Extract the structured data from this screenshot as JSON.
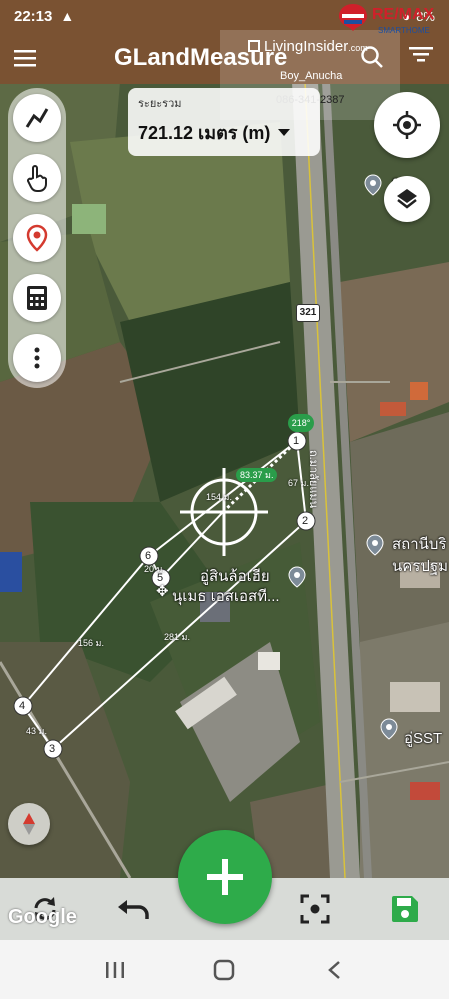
{
  "status": {
    "time": "22:13",
    "warning_icon": "warning-icon",
    "battery_text": "8%"
  },
  "app": {
    "title": "GLandMeasure"
  },
  "watermark": {
    "brand": "LivingInsider",
    "brand_suffix": ".com",
    "user": "Boy_Anucha",
    "phone": "086-341-2387",
    "remax_text": "RE/MAX",
    "remax_sub": "SMARTHOME"
  },
  "distance": {
    "label": "ระยะรวม",
    "value": "721.12 เมตร (m)"
  },
  "toolbar": {
    "tools": [
      "line-measure-icon",
      "touch-icon",
      "location-pin-icon",
      "calculator-icon",
      "more-vertical-icon"
    ]
  },
  "map": {
    "route_shield": "321",
    "road_label": "ถ.มาลัยแมน",
    "place_1": "อู่สินล้อเฮีย",
    "place_2": "นุเมธ เอสเอสที...",
    "place_3": "สถานีบริ",
    "place_4": "นครปฐม",
    "place_5": "อู่SST",
    "place_6": "ช.",
    "place_7": ") อ",
    "angle": "218°",
    "active_length": "83.37 ม.",
    "center_length": "154 ม.",
    "segments": [
      "67 ม.",
      "20 ม.",
      "156 ม.",
      "281 ม.",
      "43 ม."
    ],
    "points": [
      "1",
      "2",
      "3",
      "4",
      "5",
      "6"
    ]
  },
  "bottom": {
    "google": "Google"
  },
  "colors": {
    "appbar": "#7a5232",
    "fab": "#2eab4a",
    "save": "#2eab4a",
    "point_fill": "#ffffff"
  }
}
